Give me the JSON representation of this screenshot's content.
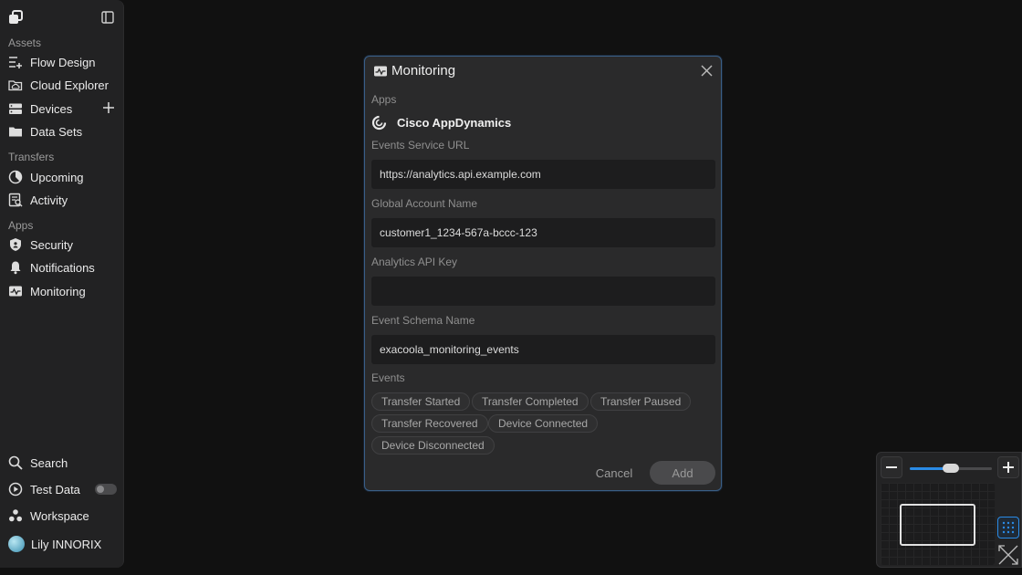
{
  "sidebar": {
    "sections": [
      {
        "label": "Assets"
      },
      {
        "label": "Transfers"
      },
      {
        "label": "Apps"
      }
    ],
    "assets": [
      {
        "label": "Flow Design",
        "icon": "flow-design-icon"
      },
      {
        "label": "Cloud Explorer",
        "icon": "cloud-explorer-icon"
      },
      {
        "label": "Devices",
        "icon": "devices-icon"
      },
      {
        "label": "Data Sets",
        "icon": "folder-icon"
      }
    ],
    "transfers": [
      {
        "label": "Upcoming",
        "icon": "pie-clock-icon"
      },
      {
        "label": "Activity",
        "icon": "activity-icon"
      }
    ],
    "apps": [
      {
        "label": "Security",
        "icon": "shield-icon"
      },
      {
        "label": "Notifications",
        "icon": "bell-icon"
      },
      {
        "label": "Monitoring",
        "icon": "monitoring-icon"
      }
    ],
    "bottom": {
      "search": "Search",
      "test_data": "Test Data",
      "test_data_enabled": false,
      "workspace": "Workspace",
      "user": "Lily INNORIX"
    }
  },
  "modal": {
    "title": "Monitoring",
    "apps_label": "Apps",
    "app_name": "Cisco AppDynamics",
    "fields": [
      {
        "label": "Events Service URL",
        "value": "https://analytics.api.example.com"
      },
      {
        "label": "Global Account Name",
        "value": "customer1_1234-567a-bccc-123"
      },
      {
        "label": "Analytics API Key",
        "value": ""
      },
      {
        "label": "Event Schema Name",
        "value": "exacoola_monitoring_events"
      }
    ],
    "events_label": "Events",
    "events": [
      "Transfer Started",
      "Transfer Completed",
      "Transfer Paused",
      "Transfer Recovered",
      "Device Connected",
      "Device Disconnected"
    ],
    "cancel_label": "Cancel",
    "add_label": "Add"
  },
  "zoom": {
    "level_fraction": 0.5
  },
  "colors": {
    "accent": "#2a8be6",
    "modal_border": "#3a5f87",
    "background": "#111111",
    "panel": "#222223"
  }
}
